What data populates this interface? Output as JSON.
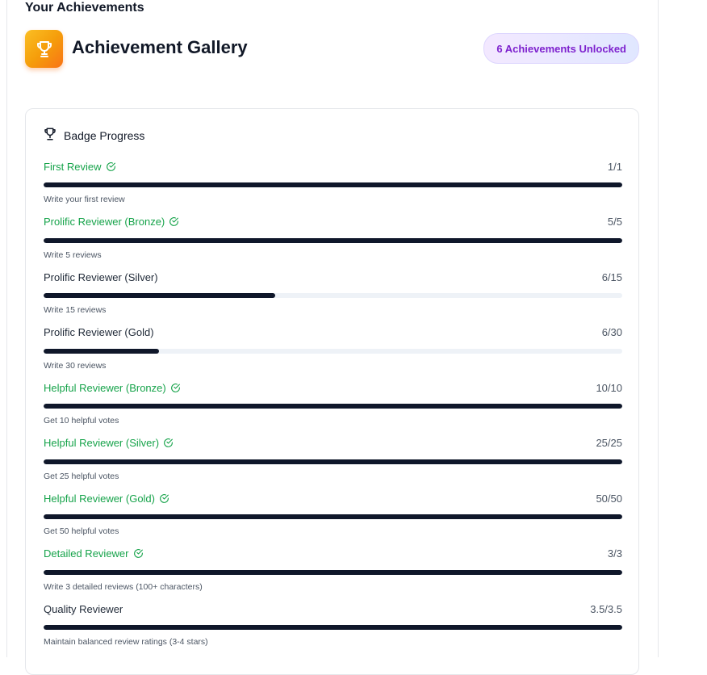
{
  "page": {
    "section_title": "Your Achievements"
  },
  "header": {
    "title": "Achievement Gallery",
    "unlocked_label": "6 Achievements Unlocked",
    "trophy_icon": "trophy-icon"
  },
  "card": {
    "title": "Badge Progress",
    "icon": "trophy-icon"
  },
  "colors": {
    "complete_text": "#16a34a",
    "bar_fill": "#0f172a",
    "bar_track": "#eef2f7",
    "badge_text": "#7e22ce"
  },
  "badges": [
    {
      "name": "First Review",
      "count": "1/1",
      "desc": "Write your first review",
      "completed": true,
      "progress": 1.0
    },
    {
      "name": "Prolific Reviewer (Bronze)",
      "count": "5/5",
      "desc": "Write 5 reviews",
      "completed": true,
      "progress": 1.0
    },
    {
      "name": "Prolific Reviewer (Silver)",
      "count": "6/15",
      "desc": "Write 15 reviews",
      "completed": false,
      "progress": 0.4
    },
    {
      "name": "Prolific Reviewer (Gold)",
      "count": "6/30",
      "desc": "Write 30 reviews",
      "completed": false,
      "progress": 0.2
    },
    {
      "name": "Helpful Reviewer (Bronze)",
      "count": "10/10",
      "desc": "Get 10 helpful votes",
      "completed": true,
      "progress": 1.0
    },
    {
      "name": "Helpful Reviewer (Silver)",
      "count": "25/25",
      "desc": "Get 25 helpful votes",
      "completed": true,
      "progress": 1.0
    },
    {
      "name": "Helpful Reviewer (Gold)",
      "count": "50/50",
      "desc": "Get 50 helpful votes",
      "completed": true,
      "progress": 1.0
    },
    {
      "name": "Detailed Reviewer",
      "count": "3/3",
      "desc": "Write 3 detailed reviews (100+ characters)",
      "completed": true,
      "progress": 1.0
    },
    {
      "name": "Quality Reviewer",
      "count": "3.5/3.5",
      "desc": "Maintain balanced review ratings (3-4 stars)",
      "completed": false,
      "progress": 1.0
    }
  ]
}
